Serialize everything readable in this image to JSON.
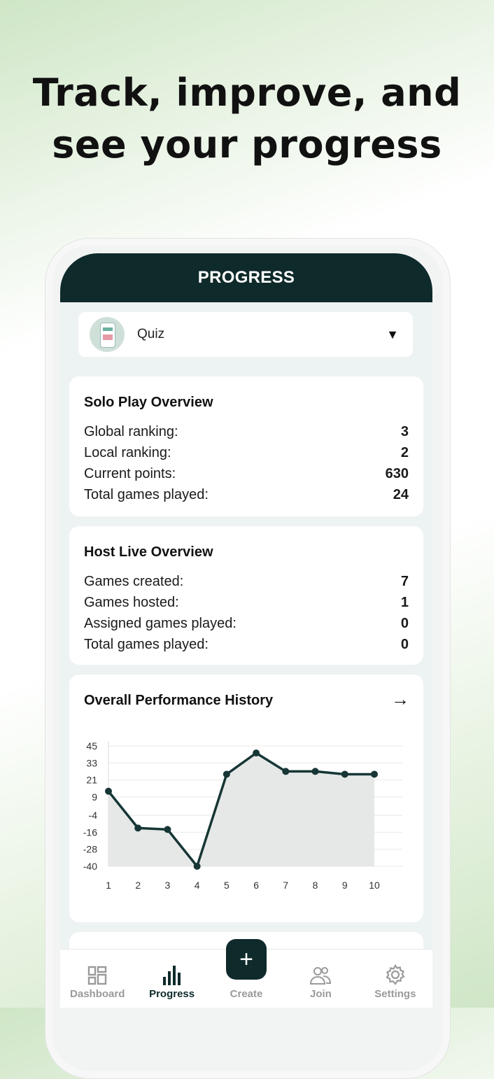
{
  "headline": {
    "line1": "Track, improve, and",
    "line2": "see your progress"
  },
  "appbar": {
    "title": "PROGRESS"
  },
  "selector": {
    "label": "Quiz",
    "caret": "▼"
  },
  "solo": {
    "title": "Solo Play Overview",
    "rows": [
      {
        "label": "Global ranking:",
        "value": "3"
      },
      {
        "label": "Local ranking:",
        "value": "2"
      },
      {
        "label": "Current points:",
        "value": "630"
      },
      {
        "label": "Total games played:",
        "value": "24"
      }
    ]
  },
  "host": {
    "title": "Host Live Overview",
    "rows": [
      {
        "label": "Games created:",
        "value": "7"
      },
      {
        "label": "Games hosted:",
        "value": "1"
      },
      {
        "label": "Assigned games played:",
        "value": "0"
      },
      {
        "label": "Total games played:",
        "value": "0"
      }
    ]
  },
  "performance": {
    "title": "Overall Performance History",
    "arrow": "→"
  },
  "chart_data": {
    "type": "area",
    "title": "",
    "xlabel": "",
    "ylabel": "",
    "x": [
      1,
      2,
      3,
      4,
      5,
      6,
      7,
      8,
      9,
      10
    ],
    "values": [
      13,
      -13,
      -14,
      -40,
      25,
      40,
      27,
      27,
      25,
      25
    ],
    "yticks": [
      45,
      33,
      21,
      9,
      -4,
      -16,
      -28,
      -40
    ],
    "ylim": [
      -40,
      45
    ],
    "grid": true,
    "colors": {
      "line": "#173636",
      "fill": "#e6e8e8",
      "grid": "#e8e8e8"
    }
  },
  "nav": {
    "items": [
      {
        "label": "Dashboard"
      },
      {
        "label": "Progress"
      },
      {
        "label": "Create"
      },
      {
        "label": "Join"
      },
      {
        "label": "Settings"
      }
    ],
    "fab": "+"
  },
  "colors": {
    "brand": "#0f2a2b",
    "background": "#edf3f2",
    "inactive": "#9a9a9a"
  }
}
